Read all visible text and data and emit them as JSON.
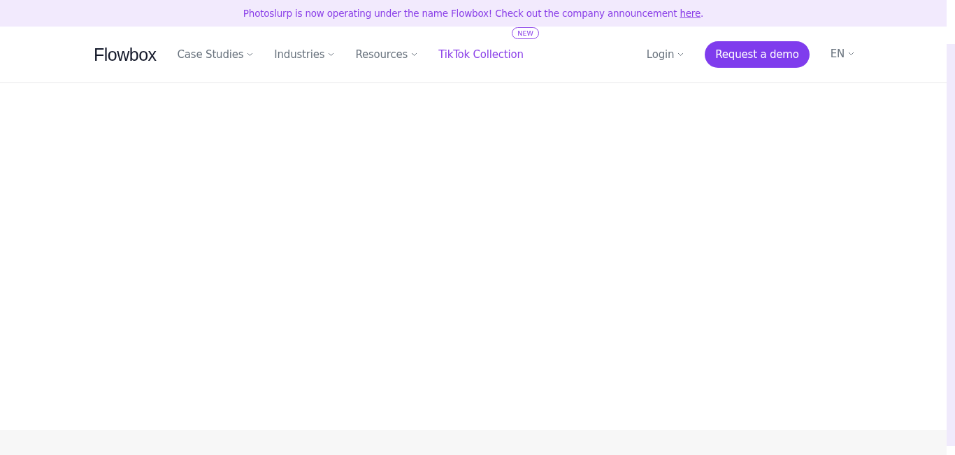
{
  "announcement": {
    "text": "Photoslurp is now operating under the name Flowbox! Check out the company announcement ",
    "link": "here",
    "after": "."
  },
  "header": {
    "logo": "Flowbox",
    "nav": [
      {
        "label": "Case Studies",
        "kind": "dropdown"
      },
      {
        "label": "Industries",
        "kind": "dropdown"
      },
      {
        "label": "Resources",
        "kind": "dropdown"
      },
      {
        "label": "TikTok Collection",
        "kind": "link",
        "badge": "NEW"
      }
    ],
    "login": "Login",
    "cta": "Request a demo",
    "language": "EN"
  }
}
